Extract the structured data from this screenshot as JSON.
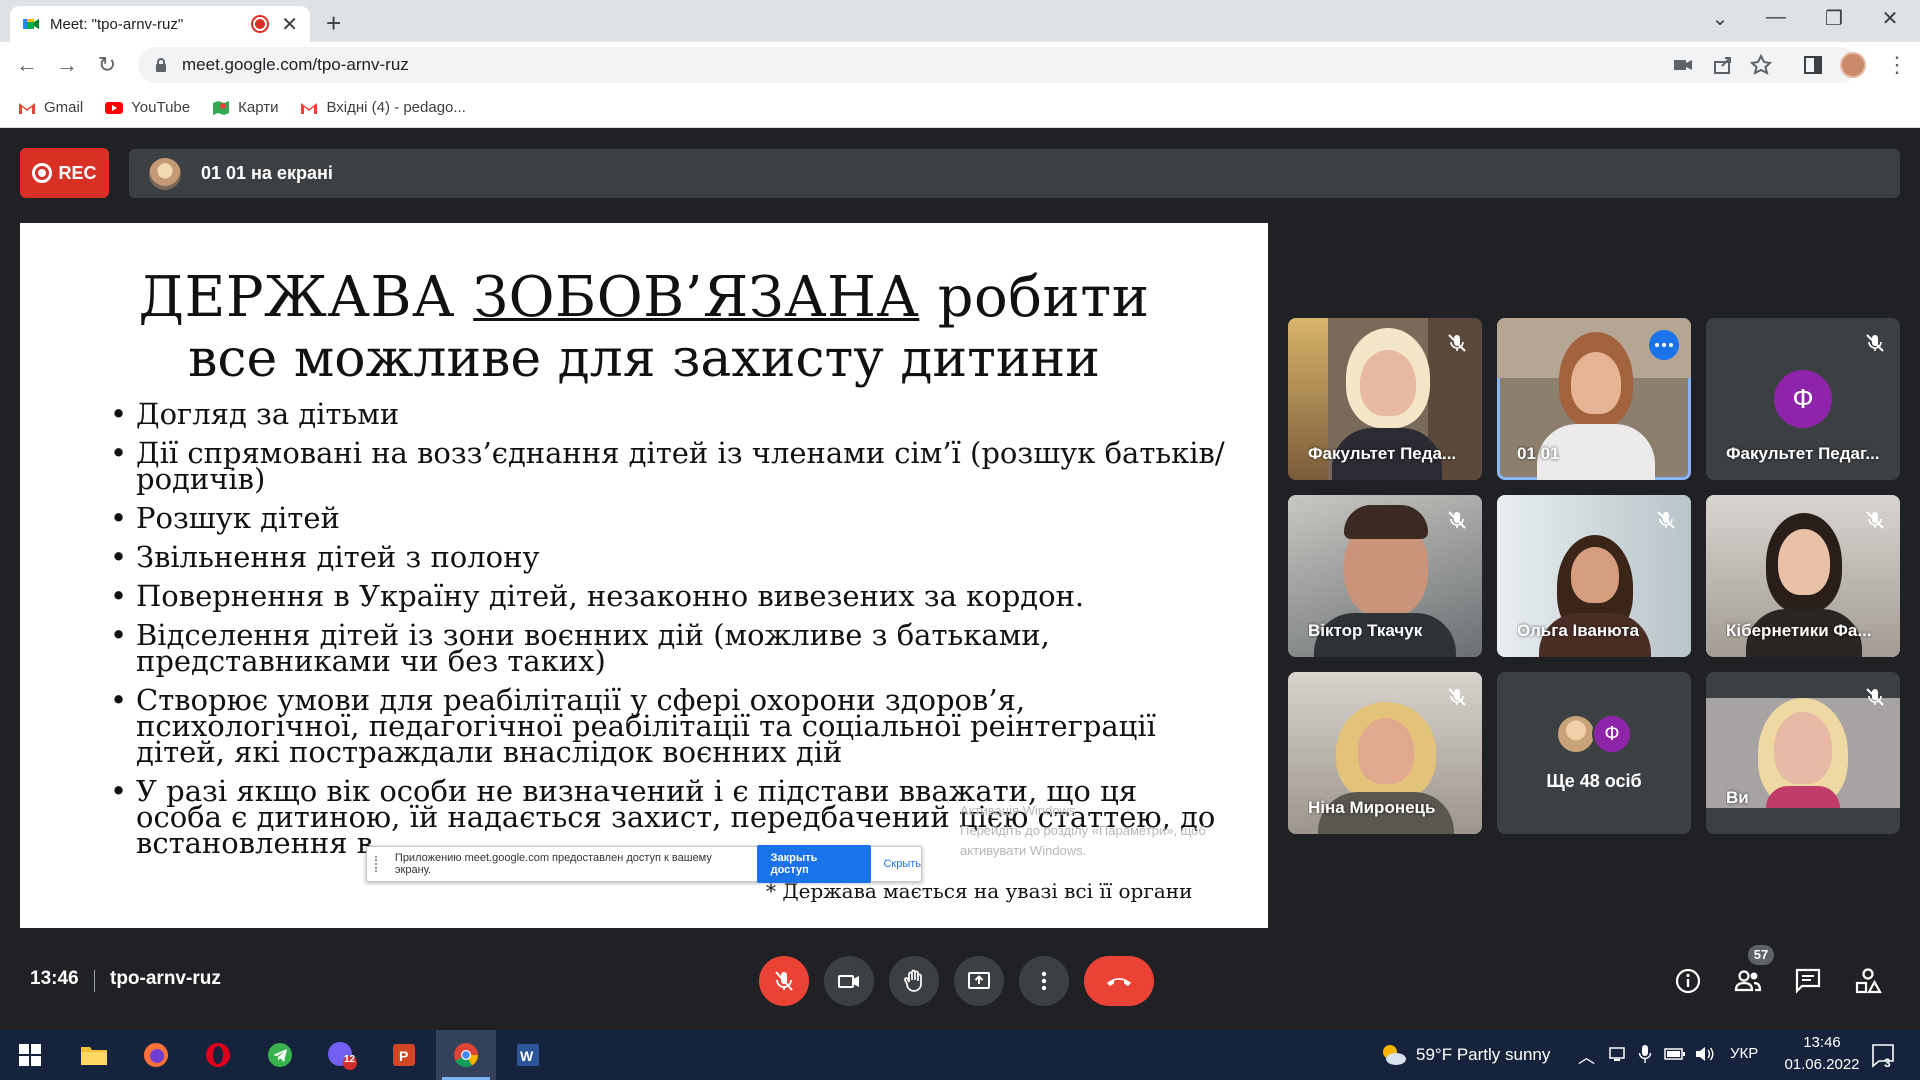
{
  "browser": {
    "tab_title": "Meet: \"tpo-arnv-ruz\"",
    "url": "meet.google.com/tpo-arnv-ruz",
    "bookmarks": [
      "Gmail",
      "YouTube",
      "Карти",
      "Вхідні (4) - pedago..."
    ]
  },
  "meet": {
    "rec_label": "REC",
    "presenter_text": "01 01 на екрані",
    "slide": {
      "title_part1": "ДЕРЖАВА",
      "title_underlined": "ЗОБОВ’ЯЗАНА",
      "title_part2": "робити",
      "title_line2": "все можливе для захисту дитини",
      "bullets": [
        "Догляд за дітьми",
        "Дії спрямовані на возз’єднання дітей із членами сім’ї (розшук батьків/родичів)",
        "Розшук дітей",
        "Звільнення дітей з полону",
        "Повернення в Україну дітей, незаконно вивезених за кордон.",
        "Відселення дітей із зони воєнних дій (можливе з батьками, представниками чи без таких)",
        "Створює умови для реабілітації у сфері охорони здоров’я, психологічної, педагогічної реабілітації та соціальної реінтеграції дітей, які постраждали внаслідок воєнних дій",
        "У разі якщо вік особи не визначений і є підстави вважати, що ця особа є дитиною, їй надається захист, передбачений цією статтею, до встановлення в"
      ],
      "footnote": "* Держава мається на увазі всі її органи",
      "activate_line1": "Активація Windows",
      "activate_line2": "Перейдіть до розділу «Параметри», щоб",
      "activate_line3": "активувати Windows."
    },
    "share_notice": {
      "text": "Приложению meet.google.com предоставлен доступ к вашему экрану.",
      "stop_label": "Закрыть доступ",
      "hide_label": "Скрыть"
    },
    "participants": [
      {
        "name": "Факультет Педа...",
        "muted": true
      },
      {
        "name": "01 01",
        "muted": false,
        "active": true
      },
      {
        "name": "Факультет Педаг...",
        "muted": true,
        "letter": "Ф"
      },
      {
        "name": "Віктор Ткачук",
        "muted": true
      },
      {
        "name": "Ольга Іванюта",
        "muted": true
      },
      {
        "name": "Кібернетики Фа...",
        "muted": true
      },
      {
        "name": "Ніна Миронець",
        "muted": true
      },
      {
        "name": "Ще 48 осіб",
        "letter": "Ф"
      },
      {
        "name": "Ви",
        "muted": true
      }
    ],
    "clock": "13:46",
    "meeting_code": "tpo-arnv-ruz",
    "people_count": "57"
  },
  "taskbar": {
    "weather": "59°F  Partly sunny",
    "lang": "УКР",
    "time": "13:46",
    "date": "01.06.2022",
    "notif_count": "3",
    "viber_badge": "12"
  },
  "colors": {
    "meet_bg": "#202124",
    "tile_bg": "#3c4043",
    "red": "#ea4335",
    "rec_red": "#d93025",
    "avatar_purple": "#8e24aa",
    "active_outline": "#8ab4f8",
    "taskbar_bg": "#16233c"
  }
}
